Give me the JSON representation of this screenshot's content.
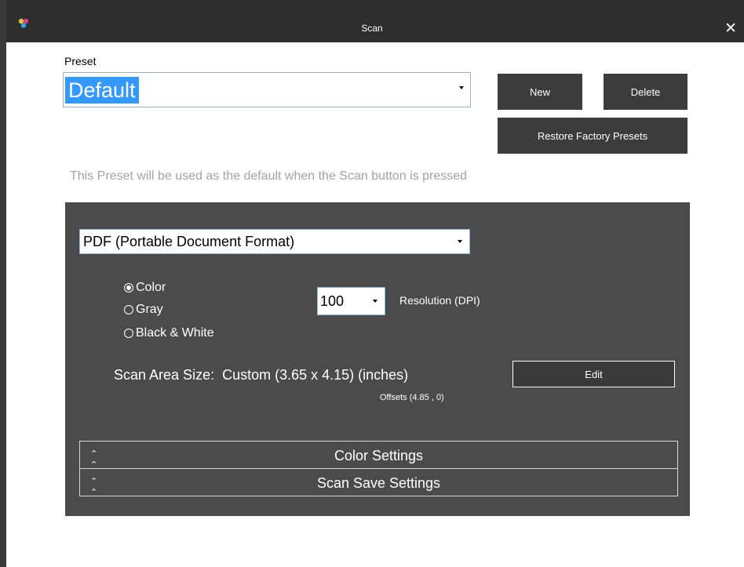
{
  "window": {
    "title": "Scan",
    "close_glyph": "✕"
  },
  "preset": {
    "label": "Preset",
    "selected": "Default",
    "new_label": "New",
    "delete_label": "Delete",
    "restore_label": "Restore Factory Presets",
    "hint": "This Preset will be used as the default when the Scan button is pressed"
  },
  "settings": {
    "format_selected": "PDF (Portable Document Format)",
    "color_modes": [
      {
        "label": "Color",
        "selected": true
      },
      {
        "label": "Gray",
        "selected": false
      },
      {
        "label": "Black & White",
        "selected": false
      }
    ],
    "resolution_value": "100",
    "resolution_label": "Resolution (DPI)",
    "scan_area_text": "Scan Area Size:  Custom (3.65 x 4.15) (inches)",
    "offsets_text": "Offsets (4.85 , 0)",
    "edit_label": "Edit",
    "sections": [
      {
        "label": "Color Settings",
        "icon": "double-chevron-up-icon"
      },
      {
        "label": "Scan Save Settings",
        "icon": "double-chevron-up-icon"
      }
    ]
  },
  "colors": {
    "titlebar": "#2e2e2e",
    "panel": "#4b4b4b",
    "button": "#3c3c3c",
    "selection": "#3399ff",
    "hint_text": "#a3a3a3"
  }
}
